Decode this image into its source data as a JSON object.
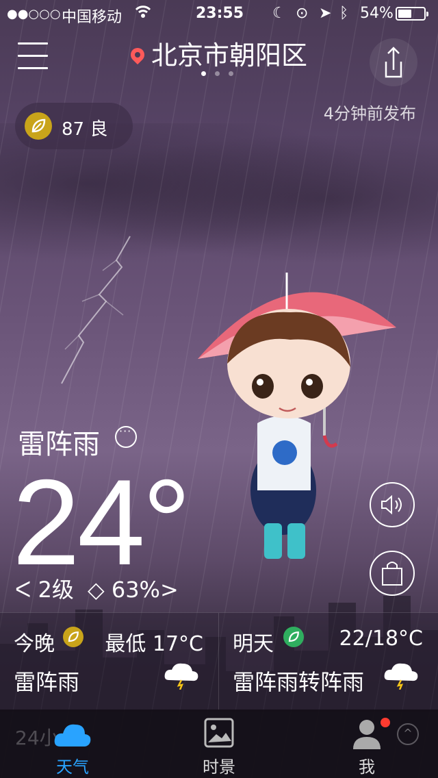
{
  "status_bar": {
    "signal": "●●○○○",
    "carrier": "中国移动",
    "time": "23:55",
    "battery_percent": "54%",
    "battery_level": 0.54
  },
  "header": {
    "location": "北京市朝阳区",
    "page_count": 3,
    "active_page": 0,
    "published": "4分钟前发布"
  },
  "aqi": {
    "value": "87",
    "level": "良",
    "color": "#c9a41a"
  },
  "current": {
    "condition": "雷阵雨",
    "temperature": "24°",
    "wind_level": "2级",
    "humidity": "63%"
  },
  "forecast": {
    "tonight": {
      "label": "今晚",
      "low": "最低 17°C",
      "condition": "雷阵雨",
      "badge_color": "#c9a41a"
    },
    "tomorrow": {
      "label": "明天",
      "range": "22/18°C",
      "condition": "雷阵雨转阵雨",
      "badge_color": "#2fae5f"
    }
  },
  "hourly_hint": "24小",
  "tabbar": {
    "tabs": [
      {
        "label": "天气",
        "icon": "cloud-icon",
        "active": true,
        "color": "#29a3ff"
      },
      {
        "label": "时景",
        "icon": "photo-icon",
        "active": false
      },
      {
        "label": "我",
        "icon": "person-icon",
        "active": false
      }
    ]
  }
}
